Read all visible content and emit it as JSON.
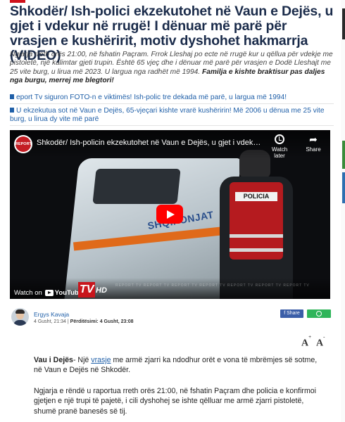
{
  "article": {
    "headline": "Shkodër/ Ish-polici ekzekutohet në Vaun e Dejës, u gjet i vdekur në rrugë! I dënuar më parë për vrasjen e kushëririt, motiv dyshohet hakmarrja (VIDEO)",
    "lead_text": "Ngjarja rreth orës 21:00, në fshatin Paçram. Frrok Lleshaj po ecte në rrugë kur u qëllua për vdekje me pistoletë, një kalimtar gjeti trupin. Është 65 vjeç dhe i dënuar më parë për vrasjen e Dodë Lleshajt me 25 vite burg, u lirua më 2023. U largua nga radhët më 1994.",
    "lead_bold": "Familja e kishte braktisur pas daljes nga burgu, merrej me blegtori!",
    "related": [
      "eport Tv siguron FOTO-n e viktimës! Ish-polic tre dekada më parë, u largua më 1994!",
      "U ekzekutua sot në Vaun e Dejës, 65-vjeçari kishte vrarë kushëririn! Më 2006 u dënua me 25 vite burg, u lirua dy vite më parë"
    ]
  },
  "video": {
    "channel_avatar_text": "REPORT TV",
    "title": "Shkodër/ Ish-policin ekzekutohet në Vaun e Dejës, u gjet i vdekur në rrugë! I...",
    "watch_later": "Watch later",
    "share": "Share",
    "watch_on": "Watch on",
    "youtube": "YouTube",
    "scene_badge": "POLICIA",
    "van_text": "SHQIPONJAT",
    "logo_tv": "TV",
    "logo_hd": "HD",
    "watermark": "REPORT TV   REPORT TV   REPORT TV   REPORT TV   REPORT TV   REPORT TV   REPORT TV"
  },
  "author": {
    "name": "Ergys Kavaja",
    "date": "4 Gusht, 21:34",
    "separator": "|",
    "updated_label": "Përditësimi:",
    "updated_value": "4 Gusht, 23:08"
  },
  "share_buttons": {
    "facebook_label": "f Share"
  },
  "font_controls": {
    "increase": "A",
    "increase_sign": "+",
    "decrease": "A",
    "decrease_sign": "-"
  },
  "body": {
    "p1_location": "Vau i Dejës",
    "p1_part1": "- Një ",
    "p1_link": "vrasje",
    "p1_part2": " me armë zjarri ka ndodhur orët e vona të mbrëmjes së sotme, në Vaun e Dejës në Shkodër.",
    "p2": "Ngjarja e rëndë u raportua rreth orës 21:00, në fshatin Paçram dhe policia e konfirmoi gjetjen e një trupi të pajetë, i cili dyshohej se ishte qëlluar me armë zjarri pistoletë, shumë pranë banesës së tij."
  }
}
